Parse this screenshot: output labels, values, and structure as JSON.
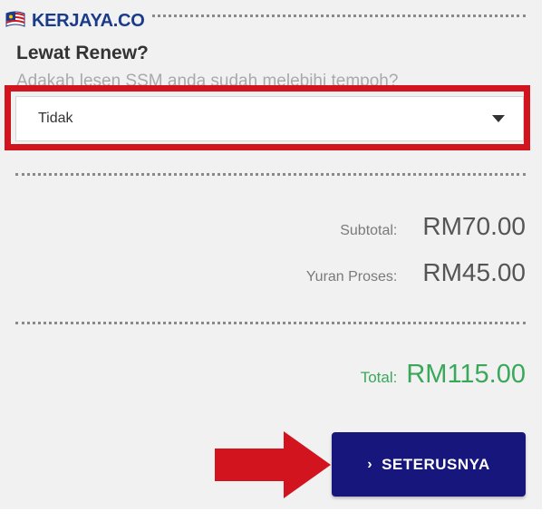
{
  "logo": {
    "text": "KERJAYA.CO"
  },
  "section": {
    "heading": "Lewat Renew?",
    "subheading": "Adakah lesen SSM anda sudah melebihi tempoh?"
  },
  "late_renew_select": {
    "value": "Tidak"
  },
  "summary": {
    "subtotal_label": "Subtotal:",
    "subtotal_value": "RM70.00",
    "fee_label": "Yuran Proses:",
    "fee_value": "RM45.00",
    "total_label": "Total:",
    "total_value": "RM115.00"
  },
  "next_button": {
    "chevron": "›",
    "label": "SETERUSNYA"
  },
  "colors": {
    "highlight": "#d2141f",
    "total_green": "#3aa85a",
    "button_navy": "#17167d"
  },
  "icons": [
    "flag-icon",
    "caret-down-icon",
    "chevron-right-icon",
    "annotation-arrow-icon"
  ]
}
